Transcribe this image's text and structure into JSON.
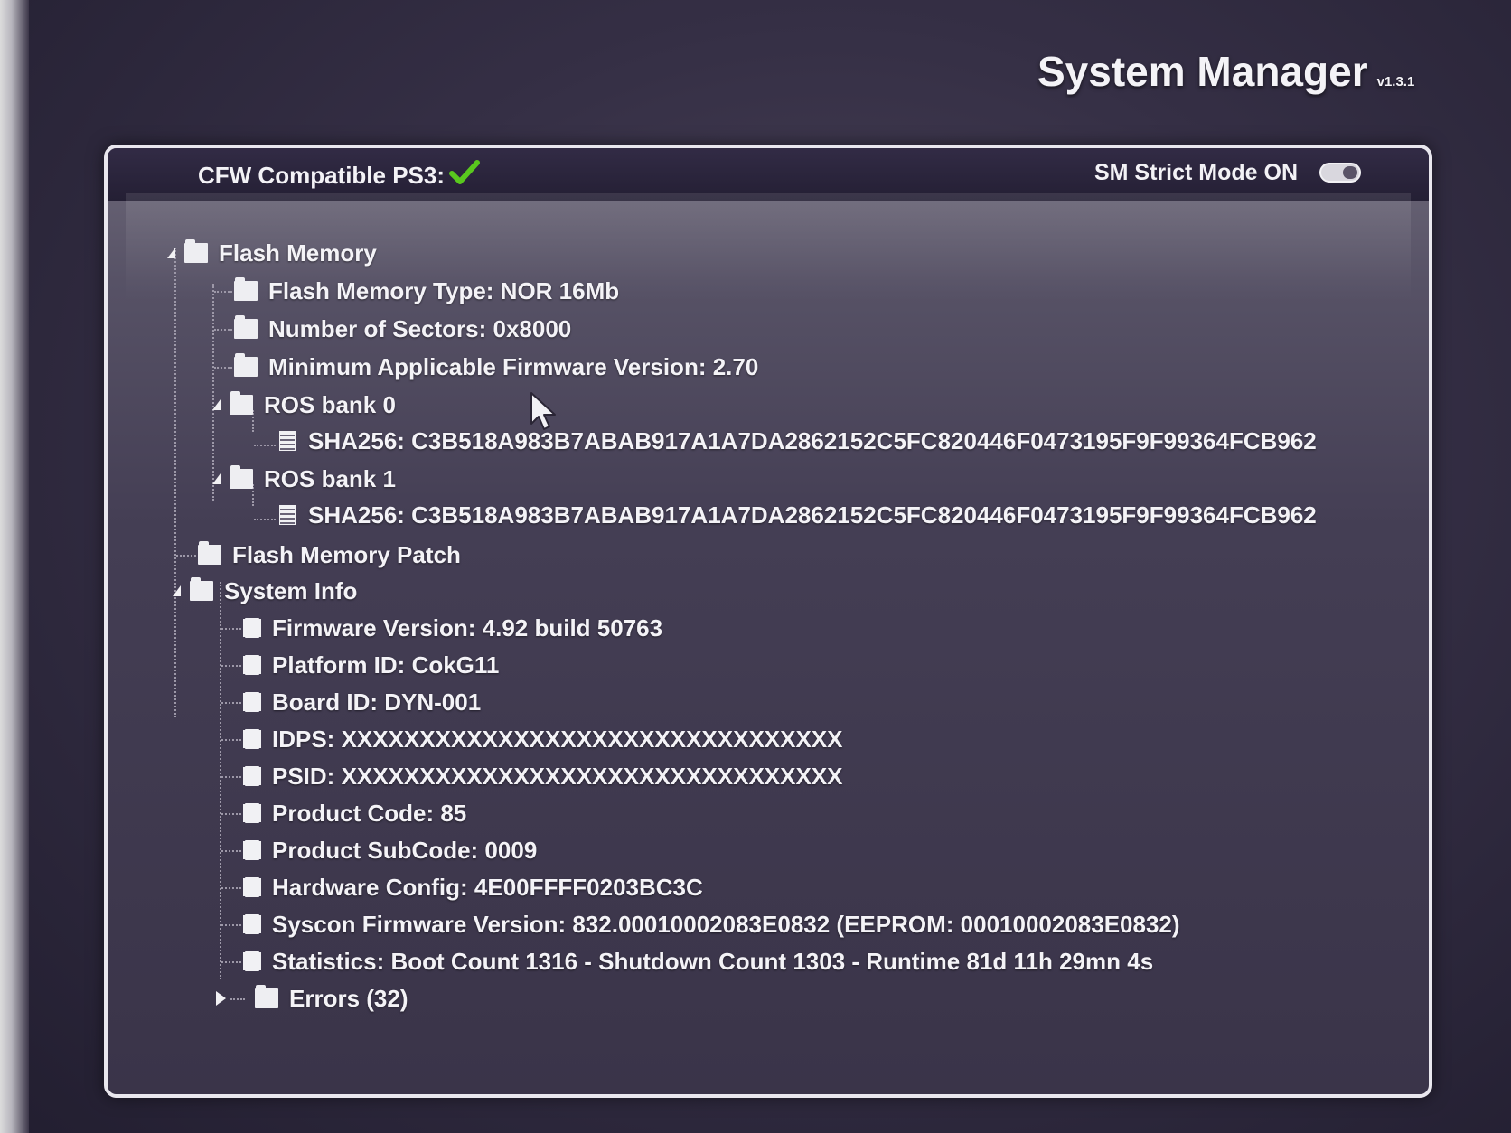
{
  "app": {
    "title": "System Manager",
    "version": "v1.3.1"
  },
  "header": {
    "compat_label": "CFW Compatible PS3:",
    "compat_status_icon": "checkmark-icon",
    "strict_mode_label": "SM Strict Mode ON",
    "strict_mode_on": true
  },
  "tree": {
    "flash_memory": {
      "label": "Flash Memory",
      "expanded": true,
      "type": "Flash Memory Type: NOR 16Mb",
      "sectors": "Number of Sectors: 0x8000",
      "min_fw": "Minimum Applicable Firmware Version: 2.70",
      "ros0": {
        "label": "ROS bank 0",
        "expanded": true,
        "sha": "SHA256: C3B518A983B7ABAB917A1A7DA2862152C5FC820446F0473195F9F99364FCB962"
      },
      "ros1": {
        "label": "ROS bank 1",
        "expanded": true,
        "sha": "SHA256: C3B518A983B7ABAB917A1A7DA2862152C5FC820446F0473195F9F99364FCB962"
      }
    },
    "flash_patch": {
      "label": "Flash Memory Patch"
    },
    "system_info": {
      "label": "System Info",
      "expanded": true,
      "items": [
        "Firmware Version: 4.92 build 50763",
        "Platform ID: CokG11",
        "Board ID: DYN-001",
        "IDPS: XXXXXXXXXXXXXXXXXXXXXXXXXXXXXXXX",
        "PSID: XXXXXXXXXXXXXXXXXXXXXXXXXXXXXXXX",
        "Product Code: 85",
        "Product SubCode: 0009",
        "Hardware Config: 4E00FFFF0203BC3C",
        "Syscon Firmware Version: 832.00010002083E0832 (EEPROM: 00010002083E0832)",
        "Statistics: Boot Count 1316 - Shutdown Count 1303 - Runtime 81d 11h 29mn 4s"
      ],
      "errors": {
        "label": "Errors (32)",
        "expanded": false
      }
    }
  }
}
